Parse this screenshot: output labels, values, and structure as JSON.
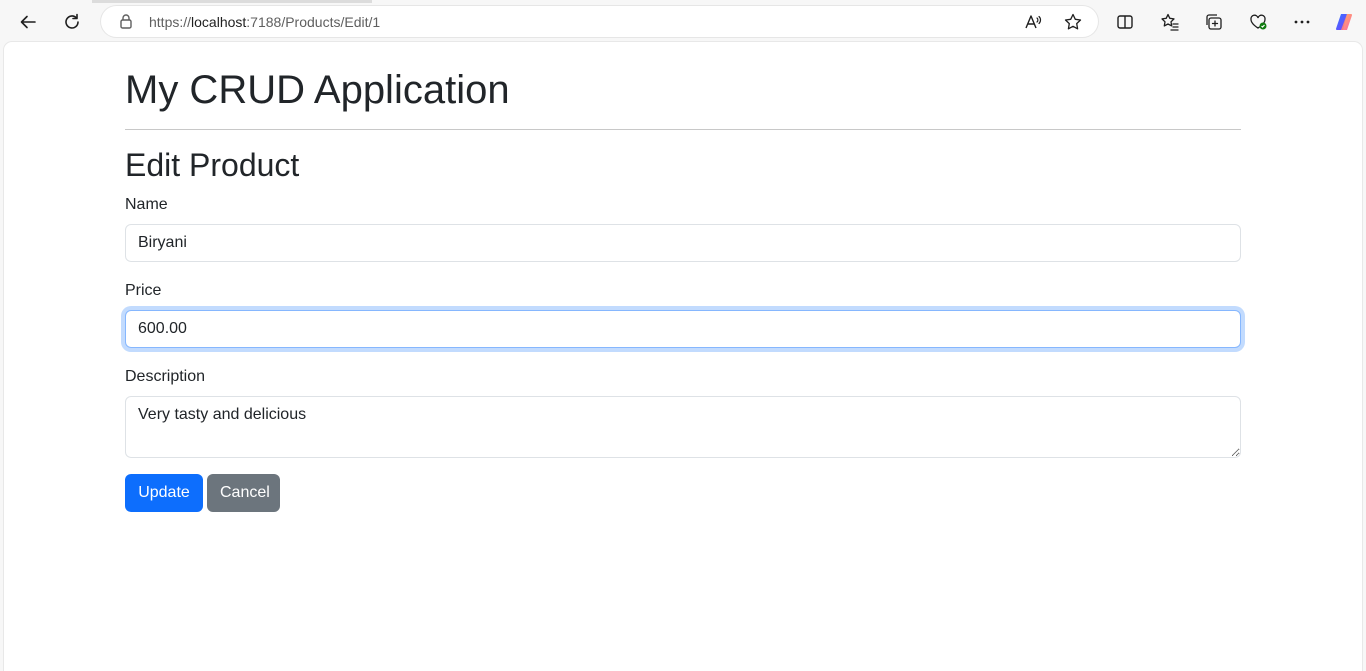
{
  "browser": {
    "url_prefix": "https://",
    "url_host": "localhost",
    "url_rest": ":7188/Products/Edit/1"
  },
  "page": {
    "app_title": "My CRUD Application",
    "title": "Edit Product"
  },
  "form": {
    "name_label": "Name",
    "name_value": "Biryani",
    "price_label": "Price",
    "price_value": "600.00",
    "description_label": "Description",
    "description_value": "Very tasty and delicious",
    "update_label": "Update",
    "cancel_label": "Cancel"
  },
  "colors": {
    "primary": "#0d6efd",
    "secondary": "#6c757d",
    "focus": "#86b7fe"
  }
}
